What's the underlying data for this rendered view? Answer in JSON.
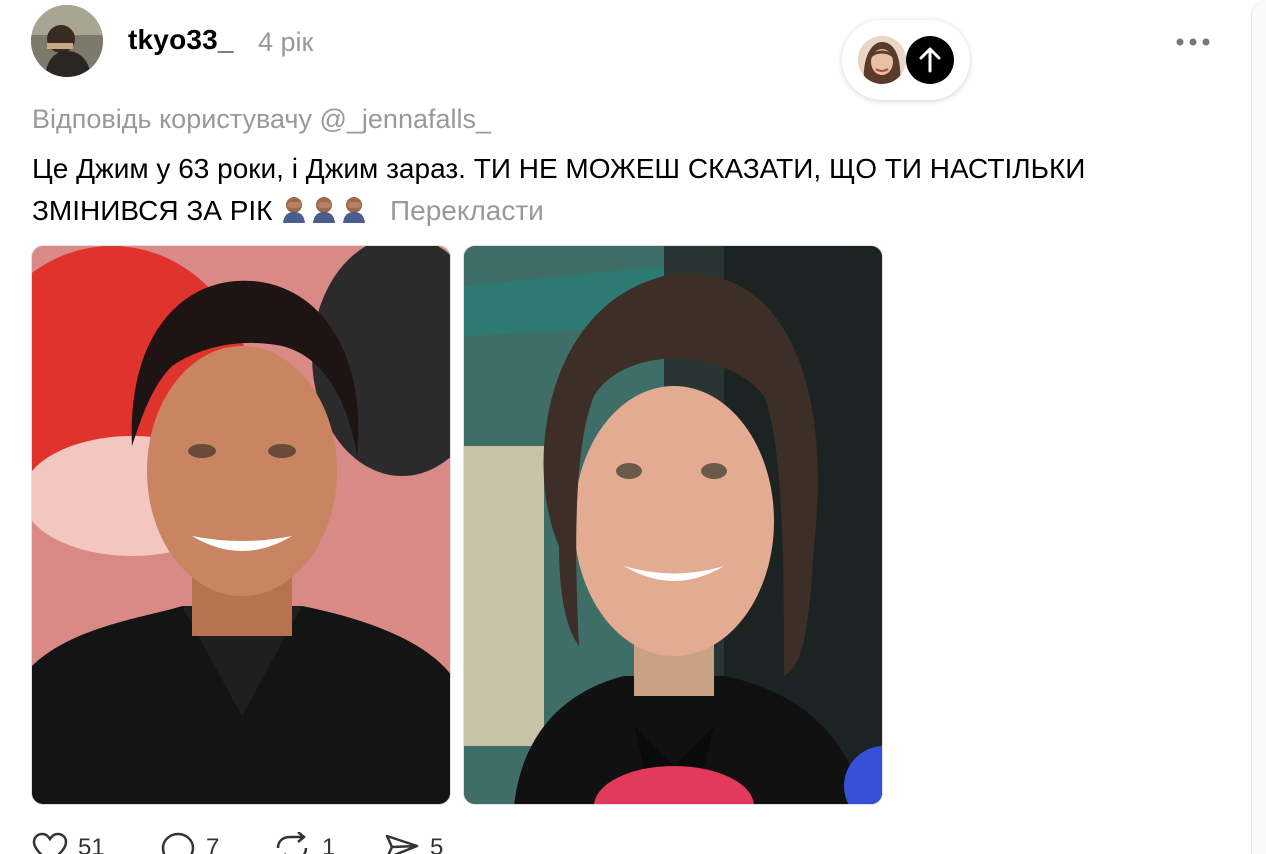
{
  "post": {
    "username": "tkyo33_",
    "time": "4 рік",
    "reply_to": "Відповідь користувачу @_jennafalls_",
    "text": "Це Джим у 63 роки, і Джим зараз. ТИ НЕ МОЖЕШ СКАЗАТИ, ЩО ТИ НАСТІЛЬКИ ЗМІНИВСЯ ЗА РІК",
    "emoji_count": 3,
    "translate_label": "Перекласти"
  },
  "media": [
    {
      "name": "photo-1"
    },
    {
      "name": "photo-2"
    }
  ],
  "actions": {
    "likes": "51",
    "comments": "7",
    "reposts": "1",
    "shares": "5"
  },
  "icons": {
    "more": "more-dots-icon",
    "scroll_top": "arrow-up-icon",
    "like": "heart-icon",
    "comment": "comment-icon",
    "repost": "repost-icon",
    "share": "send-icon"
  },
  "colors": {
    "muted_text": "#999999",
    "primary_text": "#000000"
  }
}
